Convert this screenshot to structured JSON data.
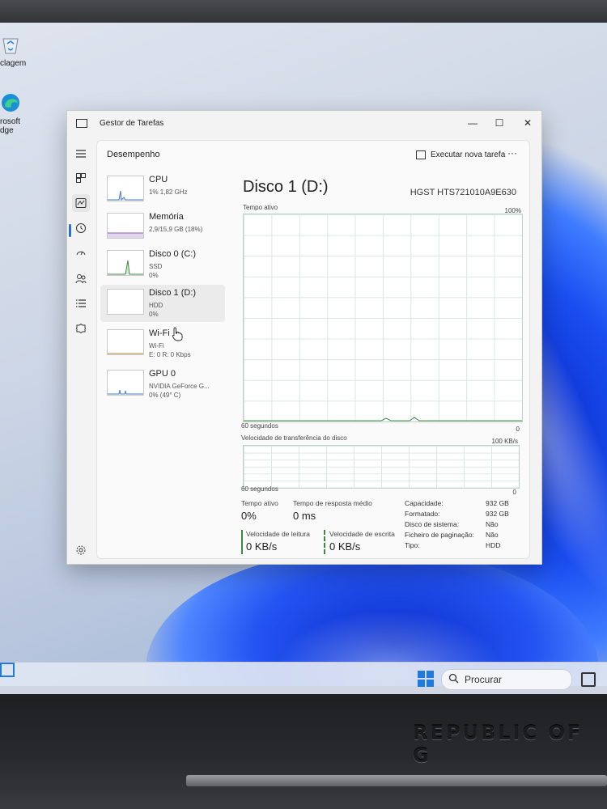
{
  "desktop": {
    "icons": [
      {
        "label": "clagem",
        "icon": "recycle-bin-icon"
      },
      {
        "label": "rosoft",
        "icon": "edge-icon"
      },
      {
        "label": "dge",
        "icon": "edge-icon"
      }
    ]
  },
  "taskbar": {
    "search_placeholder": "Procurar"
  },
  "laptop": {
    "brand_text": "REPUBLIC OF G"
  },
  "window": {
    "title": "Gestor de Tarefas",
    "controls": {
      "minimize": "—",
      "maximize": "☐",
      "close": "✕"
    }
  },
  "nav": {
    "section_title": "Desempenho",
    "run_task_label": "Executar nova tarefa",
    "more_label": "···",
    "rail_icons": [
      "hamburger-menu-icon",
      "processes-icon",
      "performance-icon",
      "app-history-icon",
      "startup-apps-icon",
      "users-icon",
      "details-icon",
      "services-icon",
      "settings-icon"
    ]
  },
  "resources": [
    {
      "name": "CPU",
      "sub1": "1% 1,82 GHz",
      "sub2": ""
    },
    {
      "name": "Memória",
      "sub1": "2,9/15,9 GB (18%)",
      "sub2": ""
    },
    {
      "name": "Disco 0 (C:)",
      "sub1": "SSD",
      "sub2": "0%"
    },
    {
      "name": "Disco 1 (D:)",
      "sub1": "HDD",
      "sub2": "0%"
    },
    {
      "name": "Wi-Fi",
      "sub1": "Wi-Fi",
      "sub2": "E: 0 R: 0 Kbps"
    },
    {
      "name": "GPU 0",
      "sub1": "NVIDIA GeForce G...",
      "sub2": "0% (49° C)"
    }
  ],
  "detail": {
    "title": "Disco 1 (D:)",
    "model": "HGST HTS721010A9E630",
    "active_label": "Tempo ativo",
    "active_max": "100%",
    "seconds_label": "60 segundos",
    "zero": "0",
    "transfer_label": "Velocidade de transferência do disco",
    "transfer_max": "100 KB/s",
    "stats": {
      "active_time_label": "Tempo ativo",
      "active_time_value": "0%",
      "response_label": "Tempo de resposta médio",
      "response_value": "0 ms",
      "read_label": "Velocidade de leitura",
      "read_value": "0 KB/s",
      "write_label": "Velocidade de escrita",
      "write_value": "0 KB/s"
    },
    "props": [
      {
        "key": "Capacidade:",
        "value": "932 GB"
      },
      {
        "key": "Formatado:",
        "value": "932 GB"
      },
      {
        "key": "Disco de sistema:",
        "value": "Não"
      },
      {
        "key": "Ficheiro de paginação:",
        "value": "Não"
      },
      {
        "key": "Tipo:",
        "value": "HDD"
      }
    ]
  },
  "colors": {
    "accent": "#2a6fd6",
    "disk_graph_line": "#3f8a3f",
    "cpu_graph": "#4a7fc1"
  }
}
